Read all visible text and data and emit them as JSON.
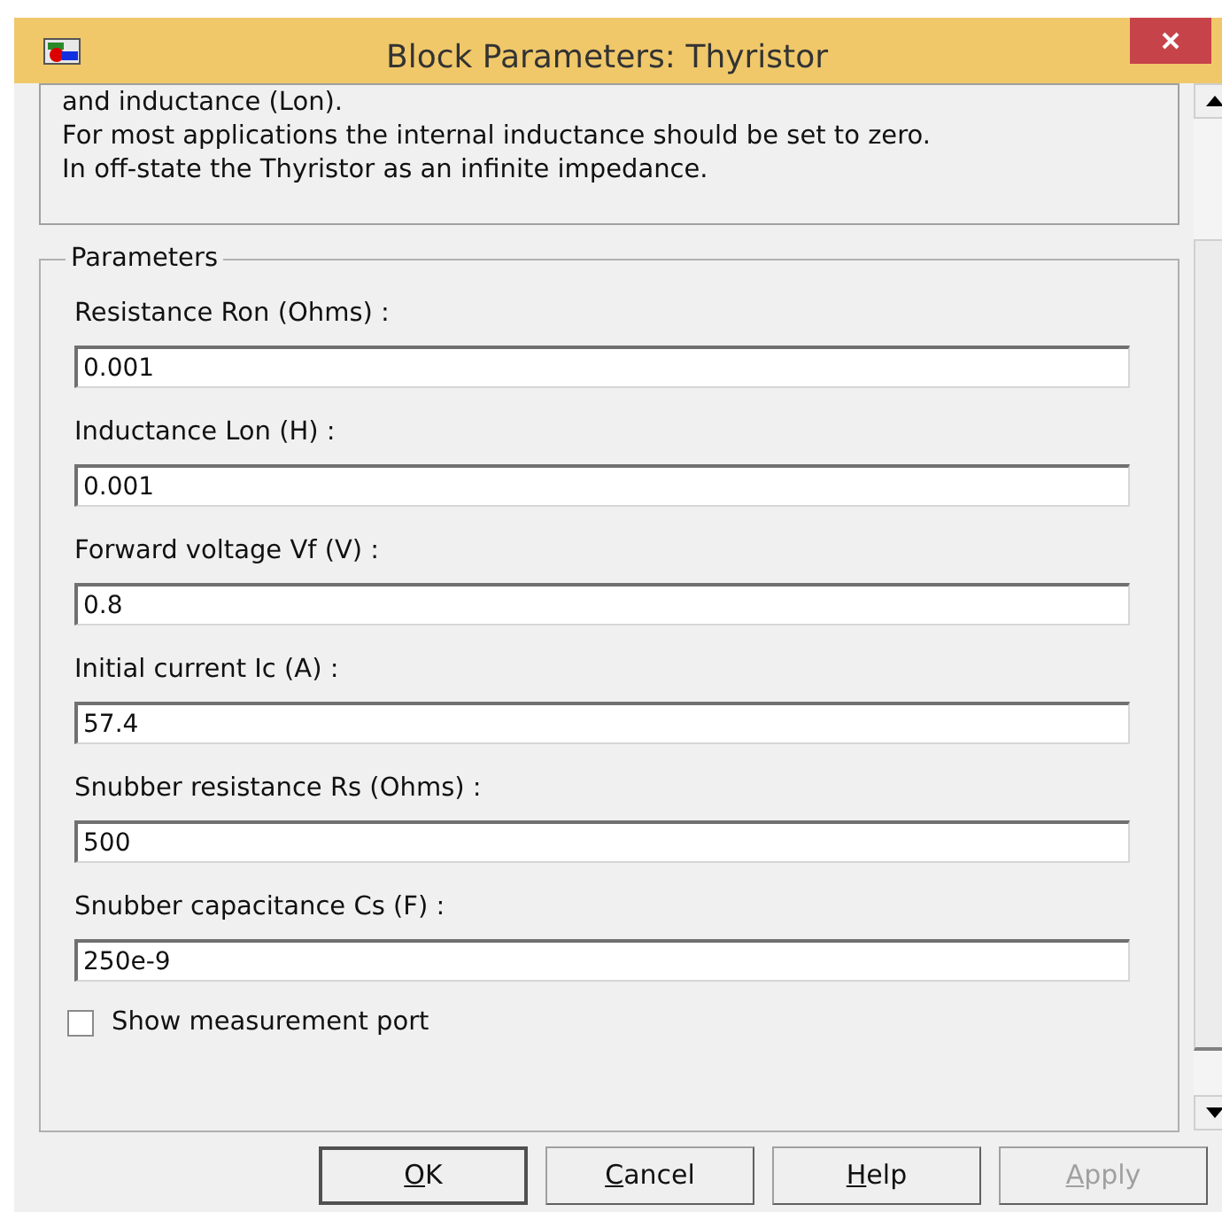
{
  "window": {
    "title": "Block Parameters: Thyristor"
  },
  "description": [
    "and inductance (Lon).",
    "For most applications the internal inductance should be set to zero.",
    "In off-state the Thyristor as an infinite impedance."
  ],
  "parameters": {
    "title": "Parameters",
    "fields": [
      {
        "label": "Resistance Ron (Ohms) :",
        "value": "0.001"
      },
      {
        "label": "Inductance Lon (H) :",
        "value": "0.001"
      },
      {
        "label": "Forward voltage Vf (V) :",
        "value": "0.8"
      },
      {
        "label": "Initial current Ic (A) :",
        "value": "57.4"
      },
      {
        "label": "Snubber resistance Rs (Ohms) :",
        "value": "500"
      },
      {
        "label": "Snubber capacitance Cs (F) :",
        "value": "250e-9"
      }
    ],
    "checkbox": {
      "label": "Show measurement port",
      "checked": false
    }
  },
  "buttons": [
    {
      "key": "O",
      "rest": "K",
      "disabled": false,
      "default": true
    },
    {
      "key": "C",
      "rest": "ancel",
      "disabled": false,
      "default": false
    },
    {
      "key": "H",
      "rest": "elp",
      "disabled": false,
      "default": false
    },
    {
      "key": "A",
      "rest": "pply",
      "disabled": true,
      "default": false
    }
  ]
}
